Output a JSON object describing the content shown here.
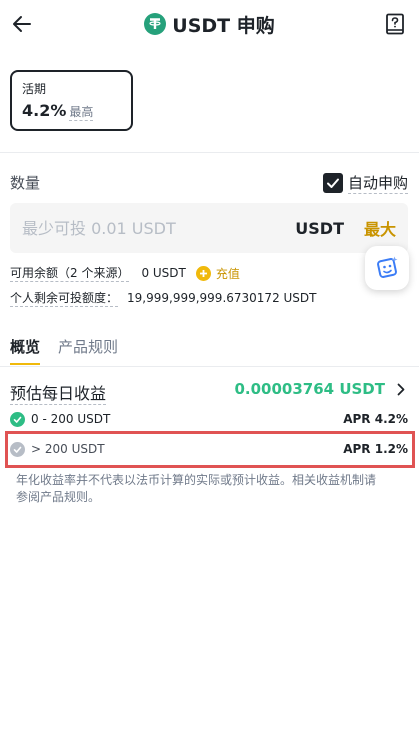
{
  "header": {
    "title": "USDT 申购",
    "coin_icon": "tether-icon",
    "coin_color": "#26a17b"
  },
  "term_card": {
    "label": "活期",
    "rate": "4.2%",
    "suffix": "最高"
  },
  "quantity": {
    "label": "数量",
    "auto_subscribe_label": "自动申购",
    "auto_subscribe_checked": true,
    "input_placeholder": "最少可投 0.01 USDT",
    "input_value": "",
    "unit": "USDT",
    "max_label": "最大"
  },
  "available": {
    "label": "可用余额（2 个来源）",
    "value": "0 USDT",
    "topup_label": "充值"
  },
  "limit": {
    "label": "个人剩余可投额度：",
    "value": "19,999,999,999.6730172 USDT"
  },
  "tabs": [
    {
      "label": "概览",
      "active": true
    },
    {
      "label": "产品规则",
      "active": false
    }
  ],
  "estimate": {
    "label": "预估每日收益",
    "value": "0.00003764 USDT"
  },
  "tiers": [
    {
      "range": "0 - 200 USDT",
      "apr": "APR 4.2%",
      "status": "active",
      "color": "#2ebd85"
    },
    {
      "range": "> 200 USDT",
      "apr": "APR 1.2%",
      "status": "inactive",
      "color": "#b7bdc6"
    }
  ],
  "note": "年化收益率并不代表以法币计算的实际或预计收益。相关收益机制请参阅产品规则。",
  "colors": {
    "accent": "#f0b90b",
    "positive": "#2ebd85",
    "highlight": "#e05353"
  }
}
